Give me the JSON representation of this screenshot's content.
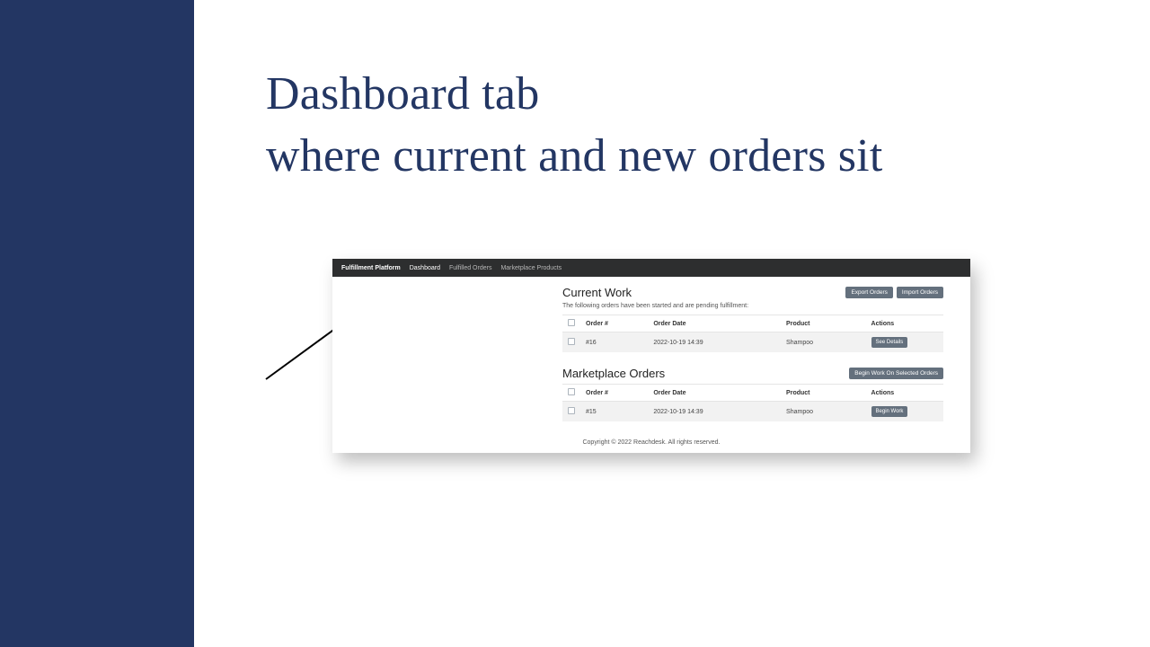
{
  "headline_line1": "Dashboard tab",
  "headline_line2": "where current and new orders sit",
  "nav": {
    "brand": "Fulfillment Platform",
    "items": [
      "Dashboard",
      "Fulfilled Orders",
      "Marketplace Products"
    ]
  },
  "buttons": {
    "export": "Export Orders",
    "import": "Import Orders",
    "see_details": "See Details",
    "begin_selected": "Begin Work On Selected Orders",
    "begin_work": "Begin Work"
  },
  "headers": {
    "order": "Order #",
    "date": "Order Date",
    "product": "Product",
    "actions": "Actions"
  },
  "current_work": {
    "title": "Current Work",
    "subtitle": "The following orders have been started and are pending fulfillment:",
    "rows": [
      {
        "order": "#16",
        "date": "2022-10-19 14:39",
        "product": "Shampoo"
      }
    ]
  },
  "marketplace": {
    "title": "Marketplace Orders",
    "rows": [
      {
        "order": "#15",
        "date": "2022-10-19 14:39",
        "product": "Shampoo"
      }
    ]
  },
  "footer": "Copyright © 2022 Reachdesk. All rights reserved."
}
